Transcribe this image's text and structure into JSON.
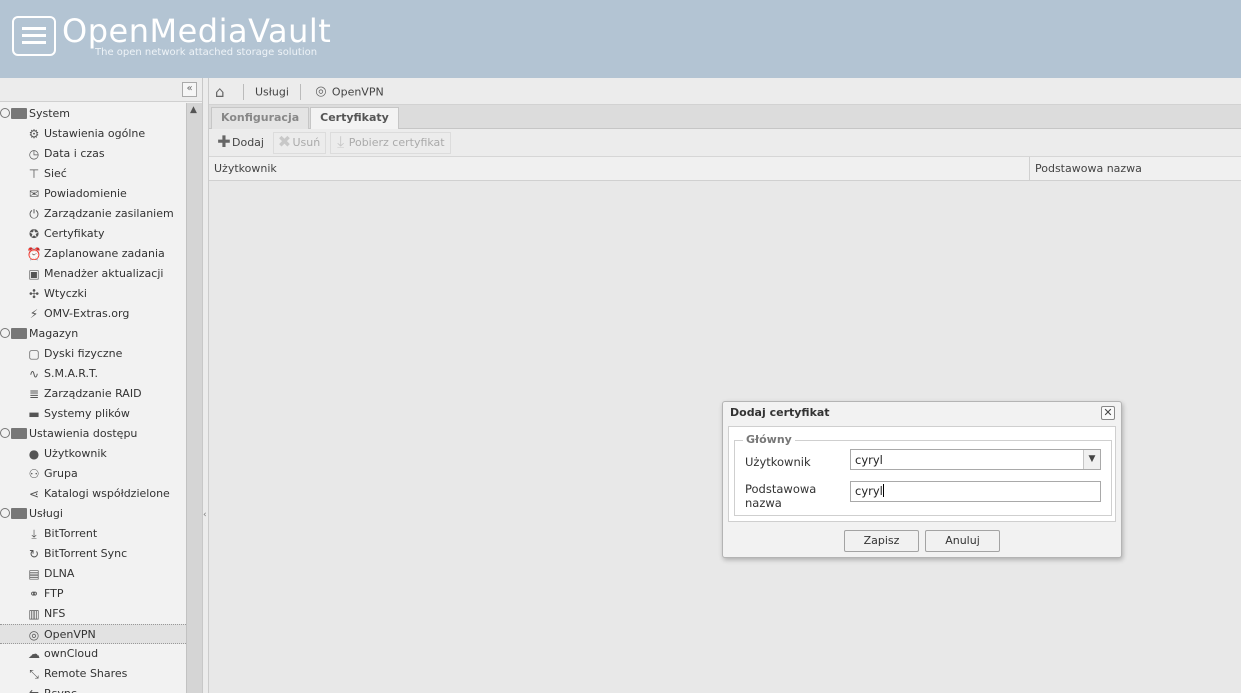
{
  "header": {
    "logo": "OpenMediaVault",
    "tagline": "The open network attached storage solution"
  },
  "sidebar": {
    "groups": [
      {
        "label": "System",
        "items": [
          {
            "label": "Ustawienia ogólne",
            "icon": "gears-icon"
          },
          {
            "label": "Data i czas",
            "icon": "clock-icon"
          },
          {
            "label": "Sieć",
            "icon": "network-icon"
          },
          {
            "label": "Powiadomienie",
            "icon": "mail-icon"
          },
          {
            "label": "Zarządzanie zasilaniem",
            "icon": "power-icon"
          },
          {
            "label": "Certyfikaty",
            "icon": "certificate-icon"
          },
          {
            "label": "Zaplanowane zadania",
            "icon": "alarm-icon"
          },
          {
            "label": "Menadżer aktualizacji",
            "icon": "update-icon"
          },
          {
            "label": "Wtyczki",
            "icon": "puzzle-icon"
          },
          {
            "label": "OMV-Extras.org",
            "icon": "plug-icon"
          }
        ]
      },
      {
        "label": "Magazyn",
        "items": [
          {
            "label": "Dyski fizyczne",
            "icon": "disk-icon"
          },
          {
            "label": "S.M.A.R.T.",
            "icon": "smart-icon"
          },
          {
            "label": "Zarządzanie RAID",
            "icon": "raid-icon"
          },
          {
            "label": "Systemy plików",
            "icon": "filesystem-icon"
          }
        ]
      },
      {
        "label": "Ustawienia dostępu",
        "items": [
          {
            "label": "Użytkownik",
            "icon": "user-icon"
          },
          {
            "label": "Grupa",
            "icon": "group-icon"
          },
          {
            "label": "Katalogi współdzielone",
            "icon": "share-icon"
          }
        ]
      },
      {
        "label": "Usługi",
        "items": [
          {
            "label": "BitTorrent",
            "icon": "download-icon"
          },
          {
            "label": "BitTorrent Sync",
            "icon": "sync-icon"
          },
          {
            "label": "DLNA",
            "icon": "film-icon"
          },
          {
            "label": "FTP",
            "icon": "ftp-icon"
          },
          {
            "label": "NFS",
            "icon": "nfs-icon"
          },
          {
            "label": "OpenVPN",
            "icon": "antenna-icon",
            "selected": true
          },
          {
            "label": "ownCloud",
            "icon": "cloud-icon"
          },
          {
            "label": "Remote Shares",
            "icon": "remote-icon"
          },
          {
            "label": "Rsync",
            "icon": "rsync-icon"
          }
        ]
      }
    ]
  },
  "breadcrumb": {
    "item1": "Usługi",
    "item2": "OpenVPN"
  },
  "tabs": {
    "t1": "Konfiguracja",
    "t2": "Certyfikaty"
  },
  "toolbar": {
    "add": "Dodaj",
    "remove": "Usuń",
    "download": "Pobierz certyfikat"
  },
  "grid": {
    "col1": "Użytkownik",
    "col2": "Podstawowa nazwa"
  },
  "dialog": {
    "title": "Dodaj certyfikat",
    "legend": "Główny",
    "user_label": "Użytkownik",
    "user_value": "cyryl",
    "cn_label_1": "Podstawowa",
    "cn_label_2": "nazwa",
    "cn_value": "cyryl",
    "save": "Zapisz",
    "cancel": "Anuluj"
  }
}
